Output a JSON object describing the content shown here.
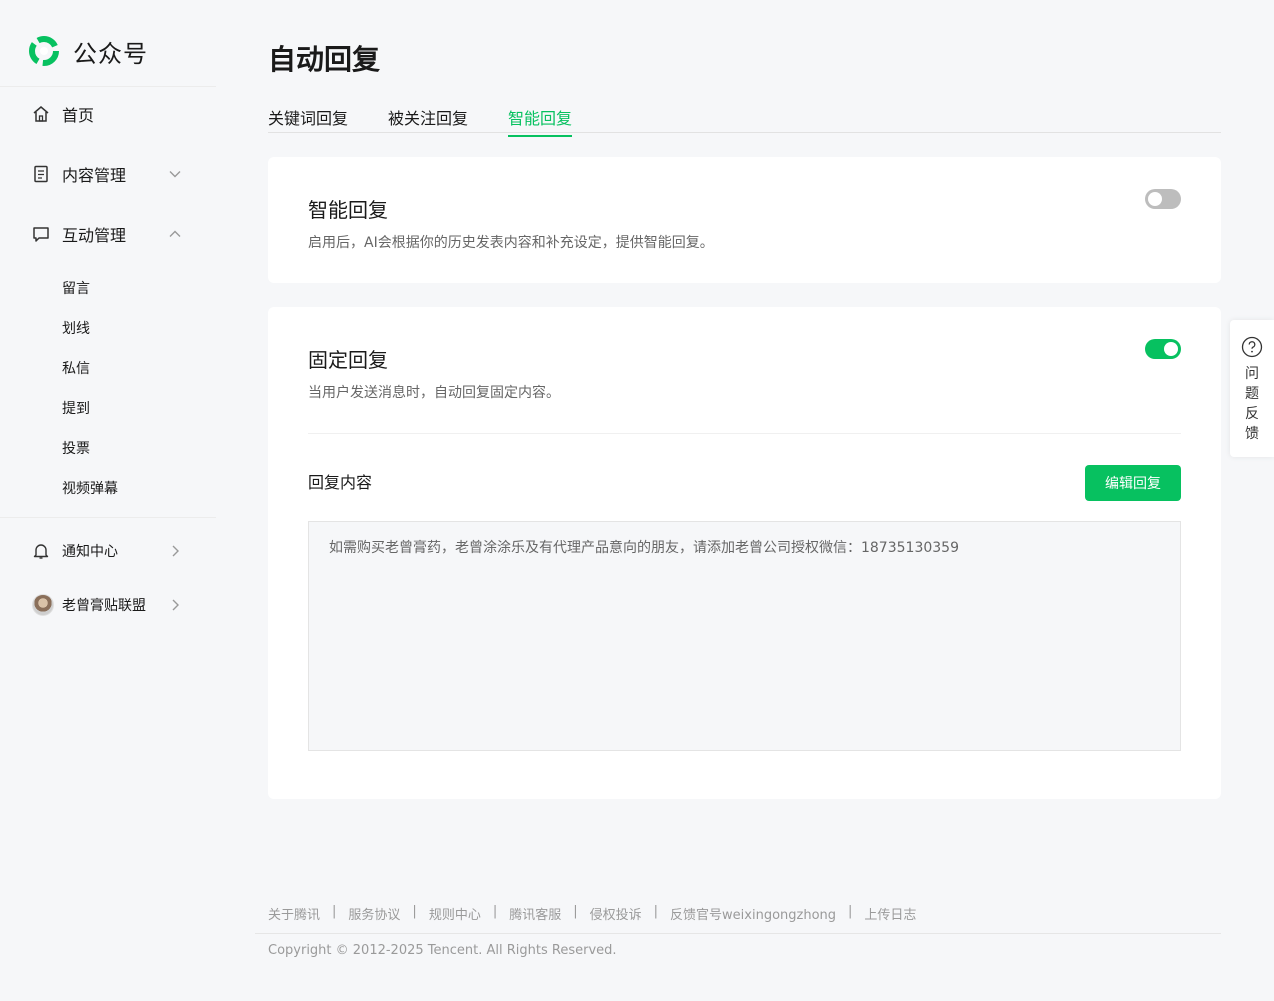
{
  "brand": {
    "name": "公众号"
  },
  "sidebar": {
    "home": "首页",
    "content_mgmt": "内容管理",
    "interaction_mgmt": "互动管理",
    "sub_items": [
      "留言",
      "划线",
      "私信",
      "提到",
      "投票",
      "视频弹幕"
    ],
    "notification_center": "通知中心",
    "account_name": "老曾膏贴联盟"
  },
  "page": {
    "title": "自动回复"
  },
  "tabs": [
    {
      "label": "关键词回复",
      "active": false
    },
    {
      "label": "被关注回复",
      "active": false
    },
    {
      "label": "智能回复",
      "active": true
    }
  ],
  "smart_reply": {
    "title": "智能回复",
    "description": "启用后，AI会根据你的历史发表内容和补充设定，提供智能回复。",
    "enabled": false
  },
  "fixed_reply": {
    "title": "固定回复",
    "description": "当用户发送消息时，自动回复固定内容。",
    "enabled": true,
    "content_label": "回复内容",
    "edit_button": "编辑回复",
    "content": "如需购买老曾膏药，老曾涂涂乐及有代理产品意向的朋友，请添加老曾公司授权微信：18735130359"
  },
  "feedback": {
    "label": "问题反馈"
  },
  "footer": {
    "links": [
      "关于腾讯",
      "服务协议",
      "规则中心",
      "腾讯客服",
      "侵权投诉",
      "反馈官号weixingongzhong",
      "上传日志"
    ],
    "copyright": "Copyright © 2012-2025 Tencent. All Rights Reserved."
  },
  "colors": {
    "accent": "#07c160",
    "background": "#f6f7f9",
    "toggle_off": "#bdbdbd"
  },
  "icons": {
    "brand": "wechat-official-account-logo",
    "home": "home-icon",
    "content": "document-icon",
    "interaction": "chat-bubble-icon",
    "notification": "bell-icon",
    "feedback": "question-circle-icon"
  }
}
